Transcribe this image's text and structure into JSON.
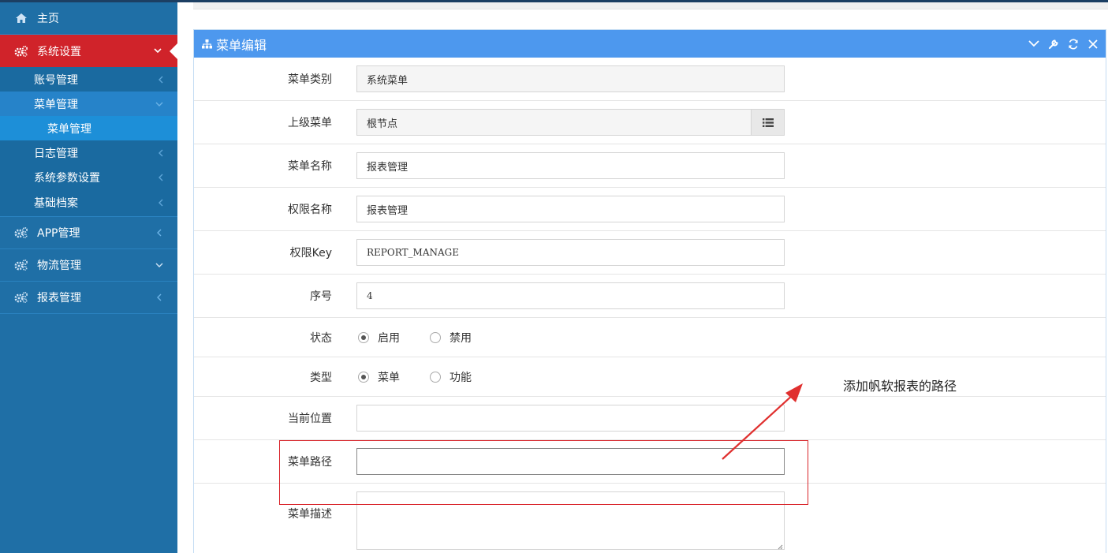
{
  "sidebar": {
    "items": [
      {
        "label": "主页"
      },
      {
        "label": "系统设置"
      },
      {
        "label": "APP管理"
      },
      {
        "label": "物流管理"
      },
      {
        "label": "报表管理"
      }
    ],
    "sub_items": [
      {
        "label": "账号管理"
      },
      {
        "label": "菜单管理"
      },
      {
        "label": "日志管理"
      },
      {
        "label": "系统参数设置"
      },
      {
        "label": "基础档案"
      }
    ],
    "subsub_item": {
      "label": "菜单管理"
    }
  },
  "panel": {
    "title": "菜单编辑"
  },
  "form": {
    "menu_category": {
      "label": "菜单类别",
      "value": "系统菜单"
    },
    "parent_menu": {
      "label": "上级菜单",
      "value": "根节点"
    },
    "menu_name": {
      "label": "菜单名称",
      "value": "报表管理"
    },
    "perm_name": {
      "label": "权限名称",
      "value": "报表管理"
    },
    "perm_key": {
      "label": "权限Key",
      "value": "REPORT_MANAGE"
    },
    "order": {
      "label": "序号",
      "value": "4"
    },
    "status": {
      "label": "状态",
      "options": [
        "启用",
        "禁用"
      ],
      "selected": "启用"
    },
    "type": {
      "label": "类型",
      "options": [
        "菜单",
        "功能"
      ],
      "selected": "菜单"
    },
    "current_pos": {
      "label": "当前位置",
      "value": ""
    },
    "menu_path": {
      "label": "菜单路径",
      "value": ""
    },
    "menu_desc": {
      "label": "菜单描述",
      "value": ""
    }
  },
  "annotation": {
    "text": "添加帆软报表的路径",
    "color": "#d9252b"
  },
  "colors": {
    "sidebar": "#1f6fa6",
    "sidebar_active": "#d0232a",
    "panel_header": "#4d98ee"
  }
}
